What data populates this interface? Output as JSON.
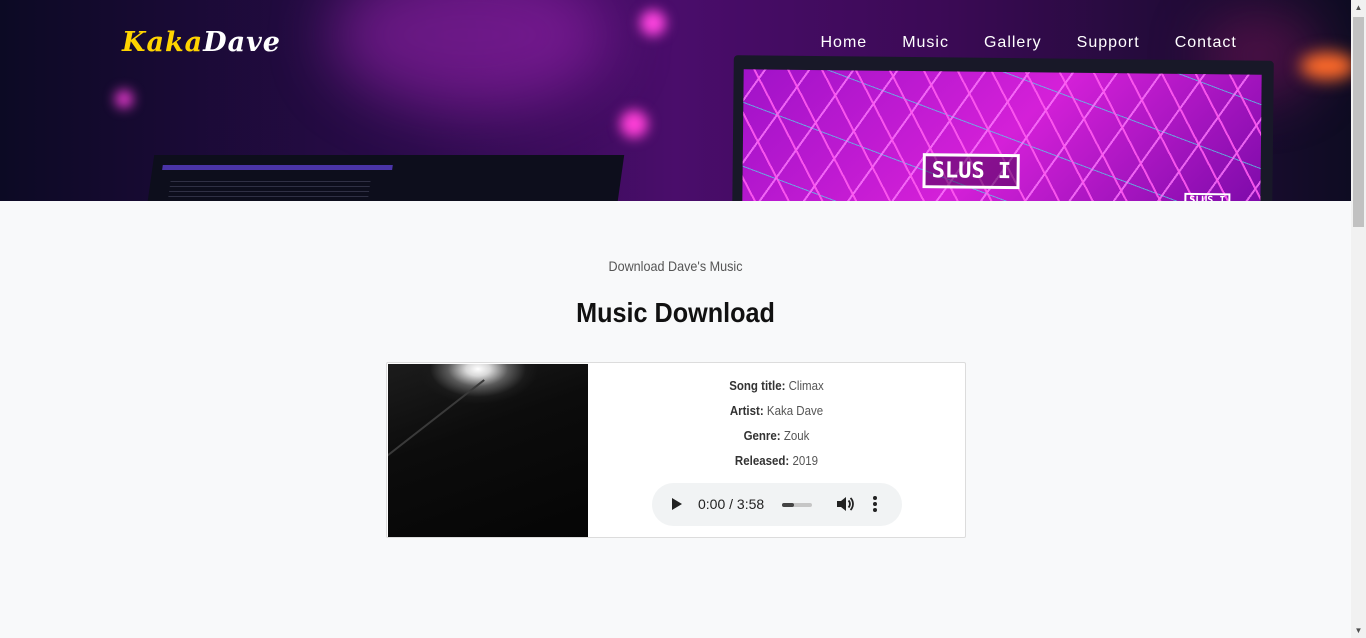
{
  "brand": {
    "part1": "Kaka",
    "part2": "Dave"
  },
  "nav": [
    {
      "label": "Home"
    },
    {
      "label": "Music"
    },
    {
      "label": "Gallery"
    },
    {
      "label": "Support"
    },
    {
      "label": "Contact"
    }
  ],
  "hero": {
    "screen_text": "SLUS I",
    "screen_text_small": "SLUS I"
  },
  "section": {
    "subtitle": "Download Dave's Music",
    "title": "Music Download"
  },
  "song": {
    "title_label": "Song title:",
    "title": "Climax",
    "artist_label": "Artist:",
    "artist": "Kaka Dave",
    "genre_label": "Genre:",
    "genre": "Zouk",
    "released_label": "Released:",
    "released": "2019"
  },
  "player": {
    "time": "0:00 / 3:58",
    "progress": 0.4
  },
  "colors": {
    "brand_accent": "#ffd400",
    "page_bg": "#f8f9fa",
    "hero_purple": "#4a0d6b"
  }
}
